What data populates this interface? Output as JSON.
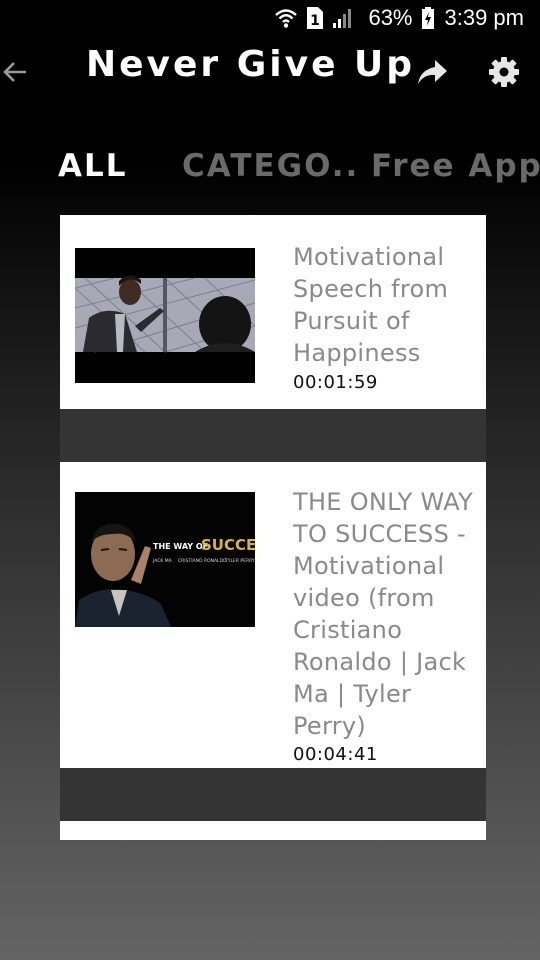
{
  "status_bar": {
    "battery": "63%",
    "time": "3:39 pm",
    "sim_label": "1",
    "icons": [
      "wifi-icon",
      "sim-icon",
      "signal-icon",
      "battery-icon"
    ]
  },
  "app_bar": {
    "title": "Never Give Up",
    "icons": [
      "back-arrow-icon",
      "share-icon",
      "gear-icon"
    ]
  },
  "tabs": [
    {
      "label": "ALL",
      "active": true
    },
    {
      "label": "CATEGO.."
    },
    {
      "label": "Free App"
    }
  ],
  "videos": [
    {
      "title": "Motivational Speech from Pursuit of Happiness",
      "duration": "00:01:59"
    },
    {
      "title": "THE ONLY WAY TO SUCCESS - Motivational video (from Cristiano Ronaldo | Jack Ma | Tyler Perry)",
      "duration": "00:04:41",
      "thumbnail_text": {
        "heading_small": "THE WAY OF",
        "heading_big": "SUCCESS",
        "names": [
          "JACK MA",
          "CRISTIANO RONALDO",
          "TYLER PERRY"
        ]
      }
    }
  ],
  "colors": {
    "tab_active": "#ffffff",
    "tab_inactive": "#6a6a6a",
    "title_text": "#8a8a8a",
    "separator": "#343434"
  }
}
